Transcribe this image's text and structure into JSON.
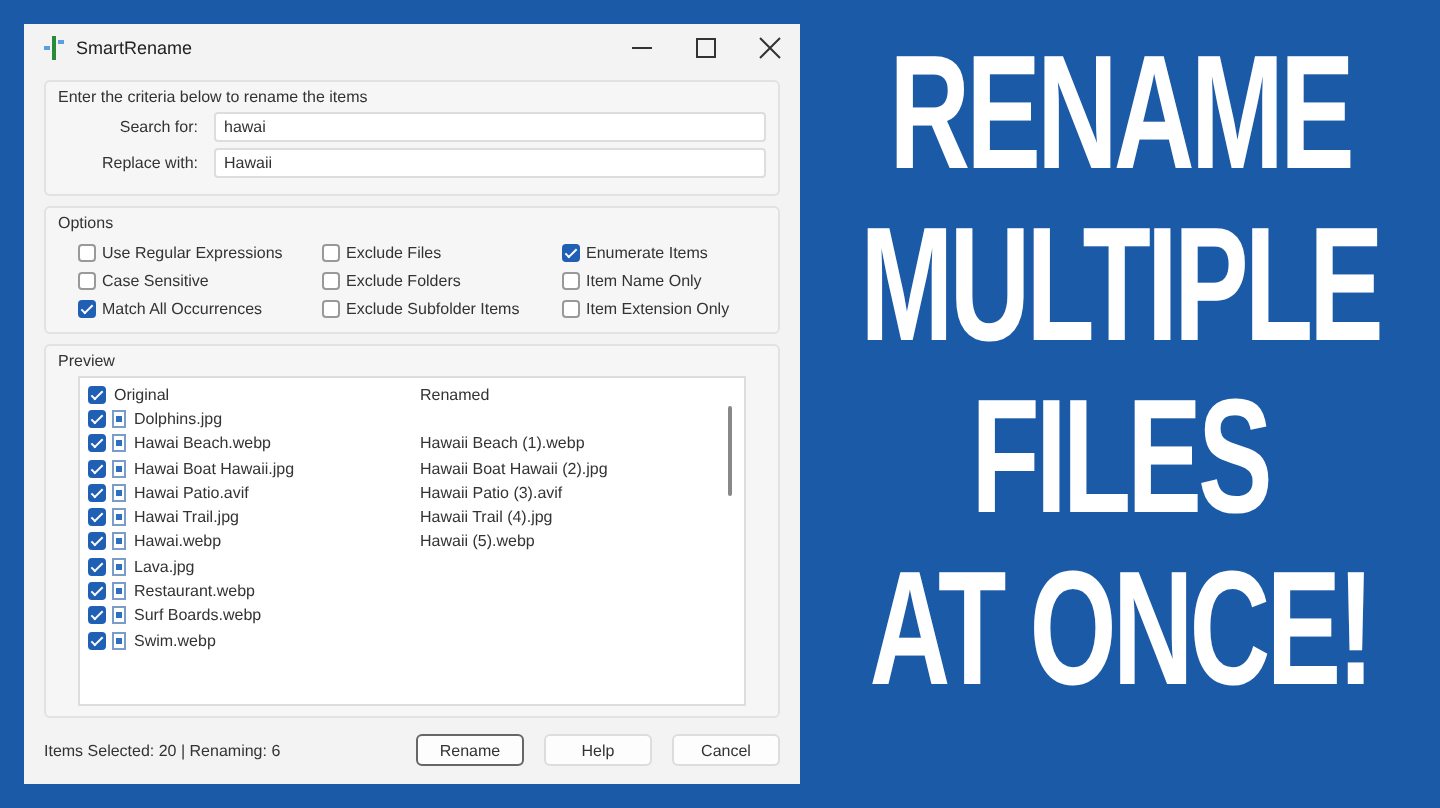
{
  "window": {
    "title": "SmartRename"
  },
  "criteria": {
    "label": "Enter the criteria below to rename the items",
    "fields": [
      {
        "label": "Search for:",
        "value": "hawai"
      },
      {
        "label": "Replace with:",
        "value": "Hawaii"
      }
    ]
  },
  "options": {
    "label": "Options",
    "items": [
      {
        "label": "Use Regular Expressions",
        "checked": false
      },
      {
        "label": "Case Sensitive",
        "checked": false
      },
      {
        "label": "Match All Occurrences",
        "checked": true
      },
      {
        "label": "Exclude Files",
        "checked": false
      },
      {
        "label": "Exclude Folders",
        "checked": false
      },
      {
        "label": "Exclude Subfolder Items",
        "checked": false
      },
      {
        "label": "Enumerate Items",
        "checked": true
      },
      {
        "label": "Item Name Only",
        "checked": false
      },
      {
        "label": "Item Extension Only",
        "checked": false
      }
    ]
  },
  "preview": {
    "label": "Preview",
    "header": {
      "original": "Original",
      "renamed": "Renamed",
      "checked": true
    },
    "rows": [
      {
        "original": "Dolphins.jpg",
        "renamed": "",
        "checked": true
      },
      {
        "original": "Hawai Beach.webp",
        "renamed": "Hawaii Beach (1).webp",
        "checked": true
      },
      {
        "original": "Hawai Boat Hawaii.jpg",
        "renamed": "Hawaii Boat Hawaii (2).jpg",
        "checked": true
      },
      {
        "original": "Hawai Patio.avif",
        "renamed": "Hawaii Patio (3).avif",
        "checked": true
      },
      {
        "original": "Hawai Trail.jpg",
        "renamed": "Hawaii Trail (4).jpg",
        "checked": true
      },
      {
        "original": "Hawai.webp",
        "renamed": "Hawaii (5).webp",
        "checked": true
      },
      {
        "original": "Lava.jpg",
        "renamed": "",
        "checked": true
      },
      {
        "original": "Restaurant.webp",
        "renamed": "",
        "checked": true
      },
      {
        "original": "Surf Boards.webp",
        "renamed": "",
        "checked": true
      },
      {
        "original": "Swim.webp",
        "renamed": "",
        "checked": true
      }
    ]
  },
  "status_bar": "Items Selected: 20 | Renaming: 6",
  "buttons": [
    {
      "label": "Rename",
      "default": true
    },
    {
      "label": "Help",
      "default": false
    },
    {
      "label": "Cancel",
      "default": false
    }
  ],
  "headline": [
    "RENAME",
    "MULTIPLE",
    "FILES",
    "AT ONCE!"
  ]
}
